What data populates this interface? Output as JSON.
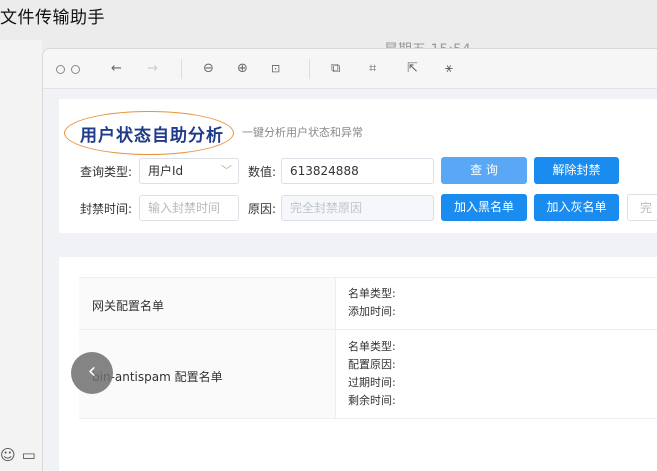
{
  "background": {
    "app_title": "文件传输助手",
    "clock": "星期五 15:54"
  },
  "viewer": {
    "toolbar": {
      "icons": [
        "close-dot",
        "minimize-dot",
        "back-arrow",
        "forward-arrow",
        "zoom-out",
        "zoom-in",
        "fit-page",
        "copy-text",
        "crop",
        "share",
        "magic-wand"
      ]
    }
  },
  "page": {
    "title": "用户状态自助分析",
    "subtitle": "一键分析用户状态和异常",
    "query_type_label": "查询类型:",
    "query_type_value": "用户Id",
    "value_label": "数值:",
    "value_input": "613824888",
    "query_button": "查 询",
    "unban_button": "解除封禁",
    "ban_time_label": "封禁时间:",
    "ban_time_placeholder": "输入封禁时间",
    "reason_label": "原因:",
    "reason_placeholder": "完全封禁原因",
    "blacklist_button": "加入黑名单",
    "graylist_button": "加入灰名单",
    "truncated_button": "完"
  },
  "table": {
    "rows": [
      {
        "name": "网关配置名单",
        "fields": [
          "名单类型:",
          "添加时间:"
        ]
      },
      {
        "name": "bin-antispam 配置名单",
        "fields": [
          "名单类型:",
          "配置原因:",
          "过期时间:",
          "剩余时间:"
        ]
      }
    ]
  },
  "overlay": {
    "prev_glyph": "‹"
  }
}
